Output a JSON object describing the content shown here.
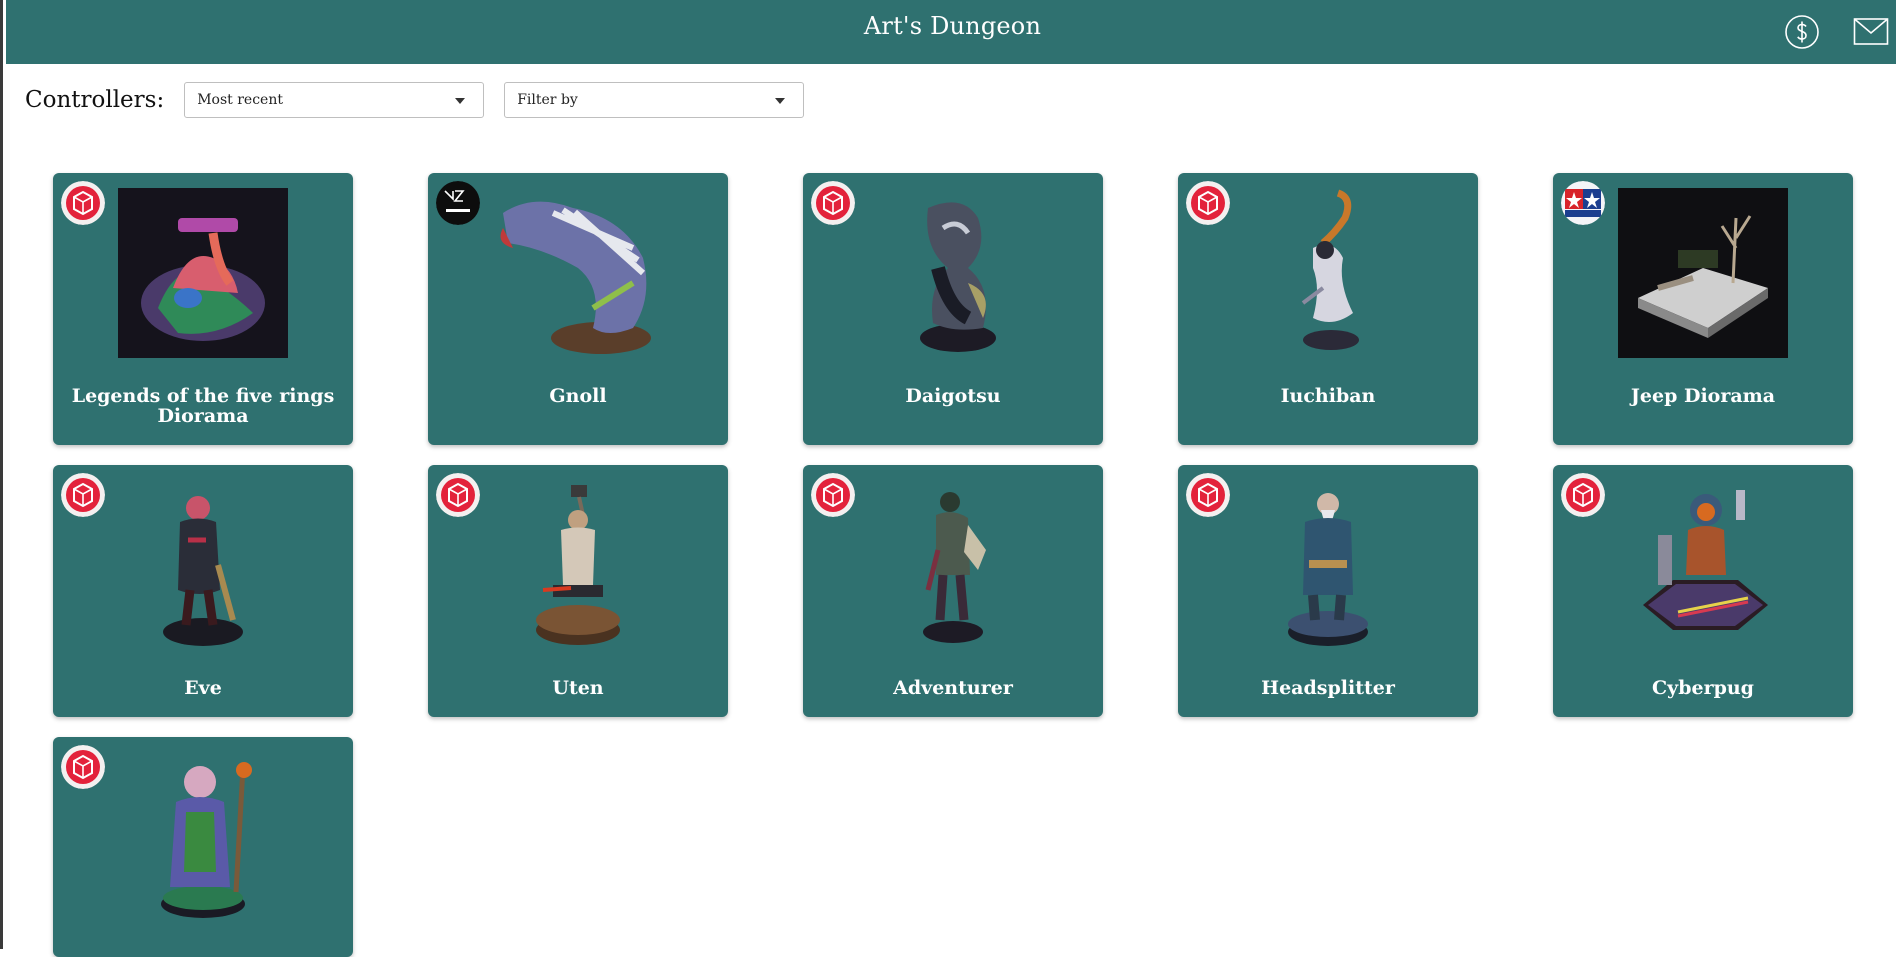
{
  "header": {
    "title": "Art's Dungeon",
    "icons": [
      "dollar-icon",
      "mail-icon"
    ]
  },
  "controls": {
    "label": "Controllers:",
    "sort": {
      "selected": "Most recent"
    },
    "filter": {
      "selected": "Filter by"
    }
  },
  "cards": [
    {
      "name": "Legends of the five rings Diorama",
      "badge": "red-cube-logo"
    },
    {
      "name": "Gnoll",
      "badge": "black-logo"
    },
    {
      "name": "Daigotsu",
      "badge": "red-cube-logo"
    },
    {
      "name": "Iuchiban",
      "badge": "red-cube-logo"
    },
    {
      "name": "Jeep Diorama",
      "badge": "tamiya-logo"
    },
    {
      "name": "Eve",
      "badge": "red-cube-logo"
    },
    {
      "name": "Uten",
      "badge": "red-cube-logo"
    },
    {
      "name": "Adventurer",
      "badge": "red-cube-logo"
    },
    {
      "name": "Headsplitter",
      "badge": "red-cube-logo"
    },
    {
      "name": "Cyberpug",
      "badge": "red-cube-logo"
    },
    {
      "name": "",
      "badge": "red-cube-logo"
    }
  ],
  "colors": {
    "accent": "#2f7170",
    "badge_red": "#e3223b"
  }
}
